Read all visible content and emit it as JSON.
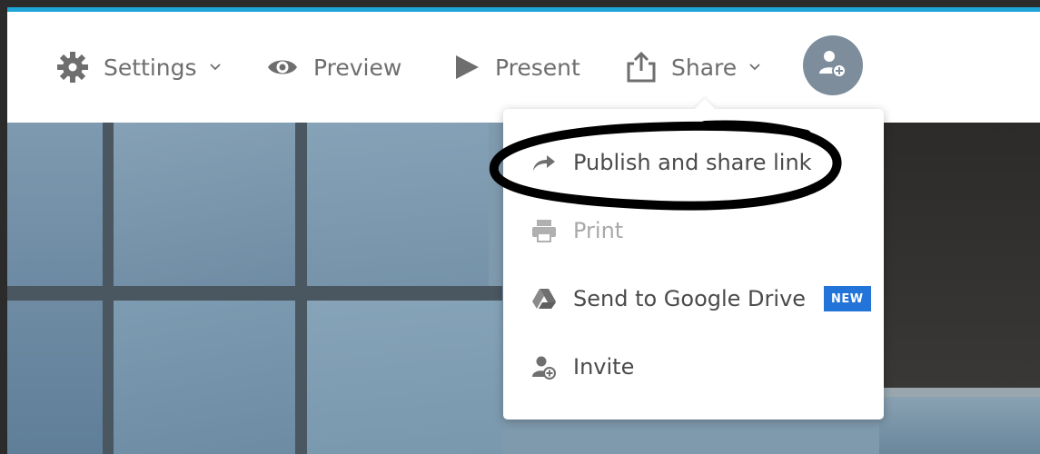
{
  "colors": {
    "accent": "#1ea5d8",
    "toolbar_text": "#6e6e6e",
    "avatar_bg": "#7d8d9c",
    "badge_bg": "#2274d9",
    "annotation": "#000000"
  },
  "toolbar": {
    "settings": {
      "label": "Settings",
      "icon": "gear-icon",
      "chevron": "chevron-down-icon"
    },
    "preview": {
      "label": "Preview",
      "icon": "eye-icon"
    },
    "present": {
      "label": "Present",
      "icon": "play-icon"
    },
    "share": {
      "label": "Share",
      "icon": "share-upload-icon",
      "chevron": "chevron-down-icon"
    },
    "avatar": {
      "icon": "add-user-icon"
    }
  },
  "share_menu": {
    "items": [
      {
        "label": "Publish and share link",
        "icon": "share-arrow-icon",
        "enabled": true,
        "annotated": true
      },
      {
        "label": "Print",
        "icon": "printer-icon",
        "enabled": false
      },
      {
        "label": "Send to Google Drive",
        "icon": "google-drive-icon",
        "enabled": true,
        "badge": "NEW"
      },
      {
        "label": "Invite",
        "icon": "add-user-icon",
        "enabled": true
      }
    ]
  }
}
